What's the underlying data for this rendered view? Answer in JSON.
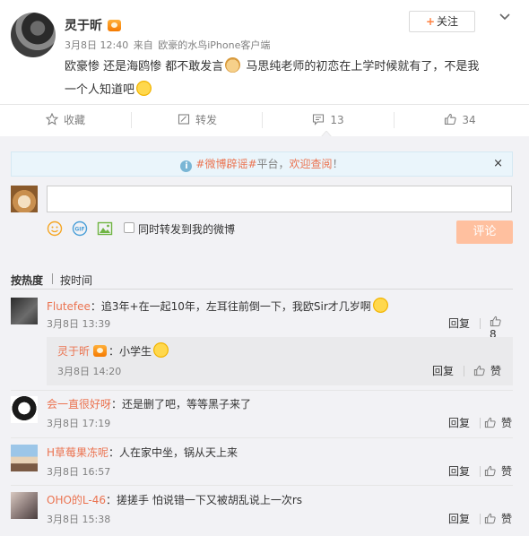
{
  "post": {
    "username": "灵于昕",
    "date": "3月8日 12:40",
    "source_prefix": "来自",
    "source": "欧豪的水鸟iPhone客户端",
    "text_part1": "欧豪惨 还是海鸥惨 都不敢发言",
    "text_part2": " 马思纯老师的初恋在上学时候就有了，不是我",
    "text_part3": "一个人知道吧",
    "follow_label": "关注"
  },
  "actions": {
    "favorite": "收藏",
    "repost": "转发",
    "comment_count": "13",
    "like_count": "34"
  },
  "notice": {
    "prefix": "",
    "link": "#微博辟谣#",
    "middle": "平台，",
    "cta": "欢迎查阅",
    "suffix": "！",
    "close": "×"
  },
  "composer": {
    "placeholder": "",
    "repost_label": "同时转发到我的微博",
    "submit_label": "评论"
  },
  "sort": {
    "hot": "按热度",
    "time": "按时间"
  },
  "comments": [
    {
      "name": "Flutefee",
      "text": "：追3年+在一起10年，左耳往前倒一下，我欧Sir才几岁啊",
      "time": "3月8日 13:39",
      "reply": "回复",
      "likes": "8"
    },
    {
      "name": "灵于昕",
      "text": "：小学生",
      "time": "3月8日 14:20",
      "reply": "回复",
      "likes": "赞"
    },
    {
      "name": "会一直很好呀",
      "text": "：还是删了吧，等等黑子来了",
      "time": "3月8日 17:19",
      "reply": "回复",
      "likes": "赞"
    },
    {
      "name": "H草莓果冻呢",
      "text": "：人在家中坐，锅从天上来",
      "time": "3月8日 16:57",
      "reply": "回复",
      "likes": "赞"
    },
    {
      "name": "OHO的L-46",
      "text": "：搓搓手  怕说错一下又被胡乱说上一次rs",
      "time": "3月8日 15:38",
      "reply": "回复",
      "likes": "赞"
    }
  ],
  "colors": {
    "accent": "#eb7350",
    "link": "#eb7350",
    "submit_disabled": "#ffc09f",
    "notice_bg": "#eaf5fb",
    "comment_bg": "#f2f2f5"
  }
}
